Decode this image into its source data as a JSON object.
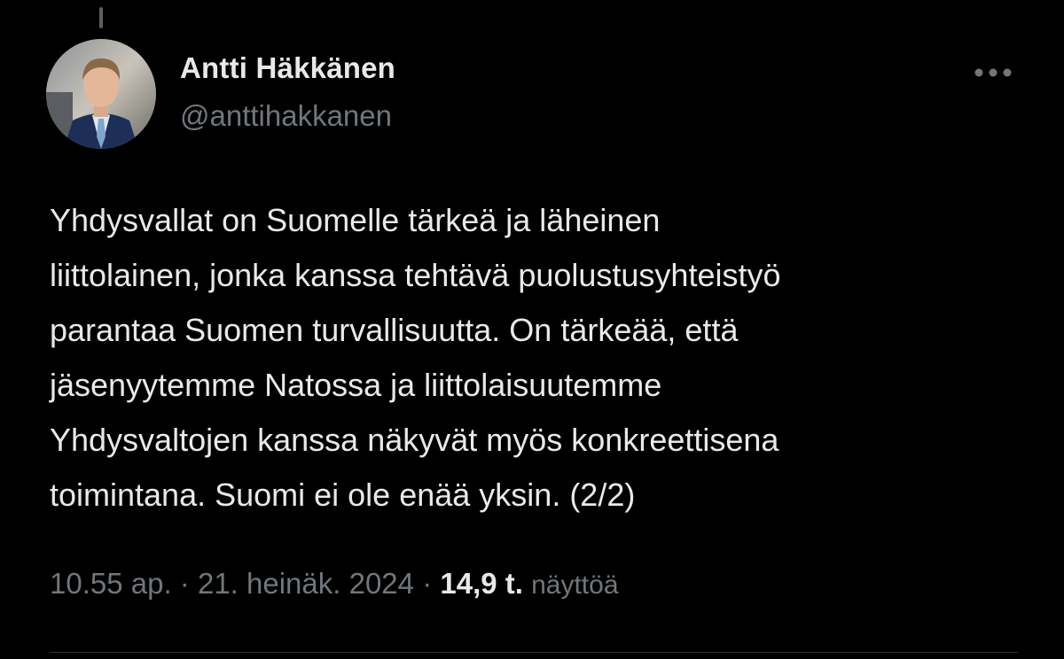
{
  "tweet": {
    "author": {
      "display_name": "Antti Häkkänen",
      "handle": "@anttihakkanen"
    },
    "text": "Yhdysvallat on Suomelle tärkeä ja läheinen\nliittolainen, jonka kanssa tehtävä puolustusyhteistyö\nparantaa Suomen turvallisuutta. On tärkeää, että\njäsenyytemme Natossa ja liittolaisuutemme\nYhdysvaltojen kanssa näkyvät myös konkreettisena\ntoimintana. Suomi ei ole enää yksin. (2/2)",
    "time": "10.55 ap.",
    "separator": "·",
    "date": "21. heinäk. 2024",
    "views_count": "14,9 t.",
    "views_label": "näyttöä"
  },
  "icons": {
    "more": "more-horizontal-icon"
  },
  "colors": {
    "background": "#000000",
    "primary_text": "#e7e9ea",
    "secondary_text": "#71767b",
    "divider": "#2f3336"
  }
}
